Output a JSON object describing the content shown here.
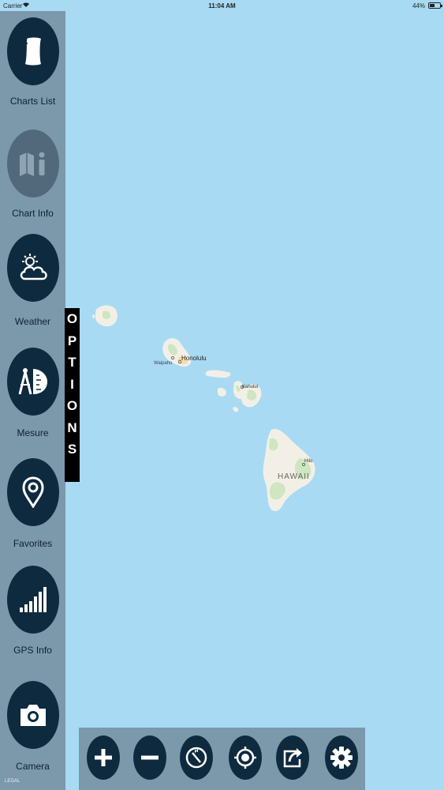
{
  "status_bar": {
    "carrier": "Carrier",
    "time": "11:04 AM",
    "battery": "44%"
  },
  "sidebar": {
    "items": [
      {
        "label": "Charts List",
        "icon": "scroll-icon"
      },
      {
        "label": "Chart Info",
        "icon": "map-info-icon"
      },
      {
        "label": "Weather",
        "icon": "sun-cloud-icon"
      },
      {
        "label": "Mesure",
        "icon": "compass-ruler-icon"
      },
      {
        "label": "Favorites",
        "icon": "location-pin-icon"
      },
      {
        "label": "GPS Info",
        "icon": "signal-bars-icon"
      },
      {
        "label": "Camera",
        "icon": "camera-icon"
      }
    ]
  },
  "options_tab": {
    "letters": [
      "O",
      "P",
      "T",
      "I",
      "O",
      "N",
      "S"
    ]
  },
  "map": {
    "labels": {
      "honolulu": "Honolulu",
      "waipahu": "Waipahu",
      "kahului": "Kahului",
      "hilo": "Hilo",
      "hawaii": "HAWAII"
    },
    "colors": {
      "water": "#a8daf3",
      "land": "#f2f0e6",
      "vegetation": "#cfe6c0"
    }
  },
  "toolbar": {
    "buttons": [
      {
        "name": "zoom-in",
        "icon": "plus-icon"
      },
      {
        "name": "zoom-out",
        "icon": "minus-icon"
      },
      {
        "name": "compass",
        "icon": "compass-icon"
      },
      {
        "name": "locate",
        "icon": "target-icon"
      },
      {
        "name": "share",
        "icon": "share-icon"
      },
      {
        "name": "settings",
        "icon": "gear-icon"
      }
    ]
  },
  "copyright": "LEGAL"
}
